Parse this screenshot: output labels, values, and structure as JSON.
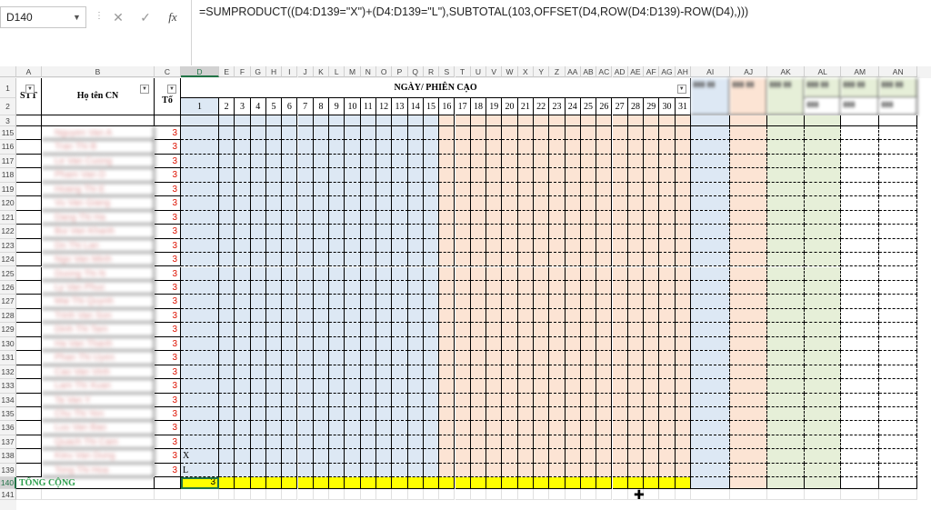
{
  "formula_bar": {
    "name_box": "D140",
    "formula": "=SUMPRODUCT((D4:D139=\"X\")+(D4:D139=\"L\"),SUBTOTAL(103,OFFSET(D4,ROW(D4:D139)-ROW(D4),)))"
  },
  "columns": [
    "A",
    "B",
    "C",
    "D",
    "E",
    "F",
    "G",
    "H",
    "I",
    "J",
    "K",
    "L",
    "M",
    "N",
    "O",
    "P",
    "Q",
    "R",
    "S",
    "T",
    "U",
    "V",
    "W",
    "X",
    "Y",
    "Z",
    "AA",
    "AB",
    "AC",
    "AD",
    "AE",
    "AF",
    "AG",
    "AH",
    "AI",
    "AJ",
    "AK",
    "AL",
    "AM",
    "AN"
  ],
  "selected_column": "D",
  "rows": [
    "1",
    "2",
    "3",
    "115",
    "116",
    "117",
    "118",
    "119",
    "120",
    "121",
    "122",
    "123",
    "124",
    "125",
    "126",
    "127",
    "128",
    "129",
    "130",
    "131",
    "132",
    "133",
    "134",
    "135",
    "136",
    "137",
    "138",
    "139",
    "140",
    "141"
  ],
  "selected_row": "140",
  "header": {
    "stt": "STT",
    "ho_ten": "Họ tên CN",
    "to": "Tổ",
    "ngay": "NGÀY/ PHIÊN CẠO",
    "days": [
      "1",
      "2",
      "3",
      "4",
      "5",
      "6",
      "7",
      "8",
      "9",
      "10",
      "11",
      "12",
      "13",
      "14",
      "15",
      "16",
      "17",
      "18",
      "19",
      "20",
      "21",
      "22",
      "23",
      "24",
      "25",
      "26",
      "27",
      "28",
      "29",
      "30",
      "31"
    ]
  },
  "data_rows": [
    {
      "row": "115",
      "name": "Nguyen Van A",
      "to": "3",
      "d": ""
    },
    {
      "row": "116",
      "name": "Tran Thi B",
      "to": "3",
      "d": ""
    },
    {
      "row": "117",
      "name": "Le Van Cuong",
      "to": "3",
      "d": ""
    },
    {
      "row": "118",
      "name": "Pham Van D",
      "to": "3",
      "d": ""
    },
    {
      "row": "119",
      "name": "Hoang Thi E",
      "to": "3",
      "d": ""
    },
    {
      "row": "120",
      "name": "Vu Van Giang",
      "to": "3",
      "d": ""
    },
    {
      "row": "121",
      "name": "Dang Thi Ha",
      "to": "3",
      "d": ""
    },
    {
      "row": "122",
      "name": "Bui Van Khanh",
      "to": "3",
      "d": ""
    },
    {
      "row": "123",
      "name": "Do Thi Lan",
      "to": "3",
      "d": ""
    },
    {
      "row": "124",
      "name": "Ngo Van Minh",
      "to": "3",
      "d": ""
    },
    {
      "row": "125",
      "name": "Duong Thi N",
      "to": "3",
      "d": ""
    },
    {
      "row": "126",
      "name": "Ly Van Phuc",
      "to": "3",
      "d": ""
    },
    {
      "row": "127",
      "name": "Mai Thi Quynh",
      "to": "3",
      "d": ""
    },
    {
      "row": "128",
      "name": "Trinh Van Son",
      "to": "3",
      "d": ""
    },
    {
      "row": "129",
      "name": "Dinh Thi Tam",
      "to": "3",
      "d": ""
    },
    {
      "row": "130",
      "name": "Ha Van Thanh",
      "to": "3",
      "d": ""
    },
    {
      "row": "131",
      "name": "Phan Thi Uyen",
      "to": "3",
      "d": ""
    },
    {
      "row": "132",
      "name": "Cao Van Vinh",
      "to": "3",
      "d": ""
    },
    {
      "row": "133",
      "name": "Lam Thi Xuan",
      "to": "3",
      "d": ""
    },
    {
      "row": "134",
      "name": "Ta Van Y",
      "to": "3",
      "d": ""
    },
    {
      "row": "135",
      "name": "Chu Thi Yen",
      "to": "3",
      "d": ""
    },
    {
      "row": "136",
      "name": "Luu Van Bao",
      "to": "3",
      "d": ""
    },
    {
      "row": "137",
      "name": "Quach Thi Cam",
      "to": "3",
      "d": ""
    },
    {
      "row": "138",
      "name": "Kieu Van Dung",
      "to": "3",
      "d": "X"
    },
    {
      "row": "139",
      "name": "Tong Thi Hoa",
      "to": "3",
      "d": "L"
    }
  ],
  "total": {
    "label": "TỔNG CỘNG",
    "value": "3"
  }
}
